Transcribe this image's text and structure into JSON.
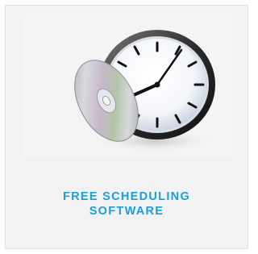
{
  "card": {
    "image_icon": "clock-with-cd-icon",
    "title_line1": "FREE SCHEDULING",
    "title_line2": "SOFTWARE"
  },
  "colors": {
    "accent": "#1a9fdb",
    "card_background": "#f2f2f2",
    "card_border": "#e1e1e1"
  }
}
